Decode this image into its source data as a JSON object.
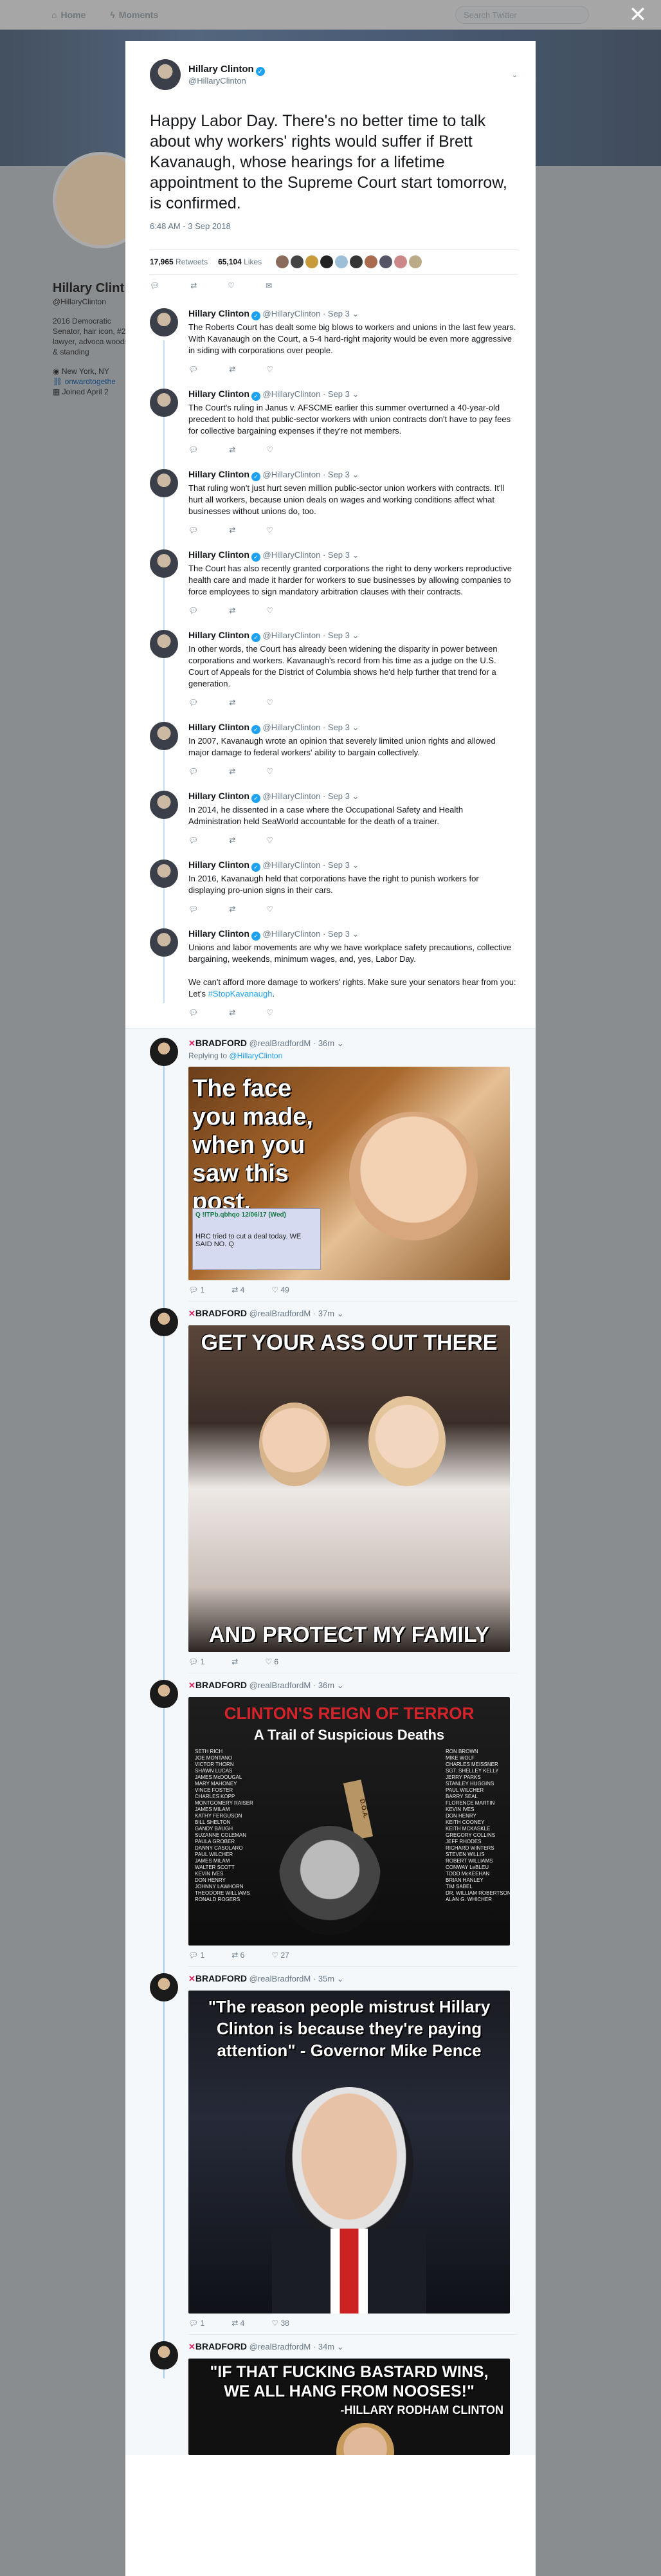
{
  "nav": {
    "home": "Home",
    "moments": "Moments",
    "search_placeholder": "Search Twitter"
  },
  "background_profile": {
    "name": "Hillary Clint",
    "handle": "@HillaryClinton",
    "bio": "2016 Democratic Senator, hair icon, #2, lawyer, advoca woods & standing",
    "location": "New York, NY",
    "link": "onwardtogethe",
    "joined": "Joined April 2"
  },
  "main_tweet": {
    "name": "Hillary Clinton",
    "handle": "@HillaryClinton",
    "text": "Happy Labor Day. There's no better time to talk about why workers' rights would suffer if Brett Kavanaugh, whose hearings for a lifetime appointment to the Supreme Court start tomorrow, is confirmed.",
    "timestamp": "6:48 AM - 3 Sep 2018",
    "retweets": "17,965",
    "retweets_label": "Retweets",
    "likes": "65,104",
    "likes_label": "Likes"
  },
  "thread": [
    {
      "name": "Hillary Clinton",
      "handle": "@HillaryClinton",
      "date": "Sep 3",
      "text": "The Roberts Court has dealt some big blows to workers and unions in the last few years. With Kavanaugh on the Court, a 5-4 hard-right majority would be even more aggressive in siding with corporations over people."
    },
    {
      "name": "Hillary Clinton",
      "handle": "@HillaryClinton",
      "date": "Sep 3",
      "text": "The Court's ruling in Janus v. AFSCME earlier this summer overturned a 40-year-old precedent to hold that public-sector workers with union contracts don't have to pay fees for collective bargaining expenses if they're not members."
    },
    {
      "name": "Hillary Clinton",
      "handle": "@HillaryClinton",
      "date": "Sep 3",
      "text": "That ruling won't just hurt seven million public-sector union workers with contracts. It'll hurt all workers, because union deals on wages and working conditions affect what businesses without unions do, too."
    },
    {
      "name": "Hillary Clinton",
      "handle": "@HillaryClinton",
      "date": "Sep 3",
      "text": "The Court has also recently granted corporations the right to deny workers reproductive health care and made it harder for workers to sue businesses by allowing companies to force employees to sign mandatory arbitration clauses with their contracts."
    },
    {
      "name": "Hillary Clinton",
      "handle": "@HillaryClinton",
      "date": "Sep 3",
      "text": "In other words, the Court has already been widening the disparity in power between corporations and workers. Kavanaugh's record from his time as a judge on the U.S. Court of Appeals for the District of Columbia shows he'd help further that trend for a generation."
    },
    {
      "name": "Hillary Clinton",
      "handle": "@HillaryClinton",
      "date": "Sep 3",
      "text": "In 2007, Kavanaugh wrote an opinion that severely limited union rights and allowed major damage to federal workers' ability to bargain collectively."
    },
    {
      "name": "Hillary Clinton",
      "handle": "@HillaryClinton",
      "date": "Sep 3",
      "text": "In 2014, he dissented in a case where the Occupational Safety and Health Administration held SeaWorld accountable for the death of a trainer."
    },
    {
      "name": "Hillary Clinton",
      "handle": "@HillaryClinton",
      "date": "Sep 3",
      "text": "In 2016, Kavanaugh held that corporations have the right to punish workers for displaying pro-union signs in their cars."
    },
    {
      "name": "Hillary Clinton",
      "handle": "@HillaryClinton",
      "date": "Sep 3",
      "text": "Unions and labor movements are why we have workplace safety precautions, collective bargaining, weekends, minimum wages, and, yes, Labor Day.",
      "text2": "We can't afford more damage to workers' rights. Make sure your senators hear from you: Let's ",
      "hashtag": "#StopKavanaugh",
      "text3": "."
    }
  ],
  "replies": [
    {
      "name": "BRADFORD",
      "handle": "@realBradfordM",
      "time": "36m",
      "replying_label": "Replying to",
      "replying_to": "@HillaryClinton",
      "meme_text": "The face you made, when you saw this post.",
      "meme_post_id": "Q !ITPb.qbhqo 12/06/17 (Wed)",
      "meme_post_body": "HRC tried to cut a deal today. WE SAID NO. Q",
      "counts": {
        "replies": "1",
        "retweets": "4",
        "likes": "49"
      }
    },
    {
      "name": "BRADFORD",
      "handle": "@realBradfordM",
      "time": "37m",
      "meme_top": "GET YOUR ASS OUT THERE",
      "meme_bottom": "AND PROTECT MY FAMILY",
      "counts": {
        "replies": "1",
        "retweets": "",
        "likes": "6"
      }
    },
    {
      "name": "BRADFORD",
      "handle": "@realBradfordM",
      "time": "36m",
      "meme_title": "CLINTON'S REIGN OF TERROR",
      "meme_sub": "A Trail of Suspicious Deaths",
      "meme_tag": "D.O.A.",
      "counts": {
        "replies": "1",
        "retweets": "6",
        "likes": "27"
      }
    },
    {
      "name": "BRADFORD",
      "handle": "@realBradfordM",
      "time": "35m",
      "meme_quote": "\"The reason people mistrust Hillary Clinton is because they're paying attention\" - Governor Mike Pence",
      "counts": {
        "replies": "1",
        "retweets": "4",
        "likes": "38"
      }
    },
    {
      "name": "BRADFORD",
      "handle": "@realBradfordM",
      "time": "34m",
      "meme_quote": "\"IF THAT FUCKING BASTARD WINS, WE ALL HANG FROM NOOSES!\"",
      "meme_attrib": "-HILLARY RODHAM CLINTON"
    }
  ]
}
